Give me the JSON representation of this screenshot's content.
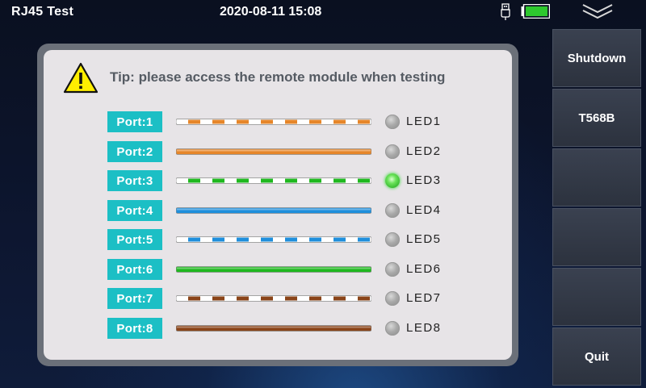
{
  "status_bar": {
    "title": "RJ45 Test",
    "datetime": "2020-08-11 15:08",
    "usb_icon": "usb-plug-icon",
    "battery_icon": "battery-icon",
    "battery_color": "#2ec82e",
    "menu_icon": "double-chevron-down-icon"
  },
  "sidebar": {
    "buttons": [
      {
        "label": "Shutdown"
      },
      {
        "label": "T568B"
      },
      {
        "label": ""
      },
      {
        "label": ""
      },
      {
        "label": ""
      },
      {
        "label": "Quit"
      }
    ]
  },
  "panel": {
    "tip_icon": "warning-triangle-icon",
    "tip": "Tip: please access the remote module when testing",
    "ports": [
      {
        "label": "Port:1",
        "led": "LED1",
        "led_on": false,
        "wire_color": "#e6862a",
        "striped": true
      },
      {
        "label": "Port:2",
        "led": "LED2",
        "led_on": false,
        "wire_color": "#e6862a",
        "striped": false
      },
      {
        "label": "Port:3",
        "led": "LED3",
        "led_on": true,
        "wire_color": "#1fb81f",
        "striped": true
      },
      {
        "label": "Port:4",
        "led": "LED4",
        "led_on": false,
        "wire_color": "#1f8fdc",
        "striped": false
      },
      {
        "label": "Port:5",
        "led": "LED5",
        "led_on": false,
        "wire_color": "#1f8fdc",
        "striped": true
      },
      {
        "label": "Port:6",
        "led": "LED6",
        "led_on": false,
        "wire_color": "#1fb81f",
        "striped": false
      },
      {
        "label": "Port:7",
        "led": "LED7",
        "led_on": false,
        "wire_color": "#8a4419",
        "striped": true
      },
      {
        "label": "Port:8",
        "led": "LED8",
        "led_on": false,
        "wire_color": "#8a4419",
        "striped": false
      }
    ]
  }
}
